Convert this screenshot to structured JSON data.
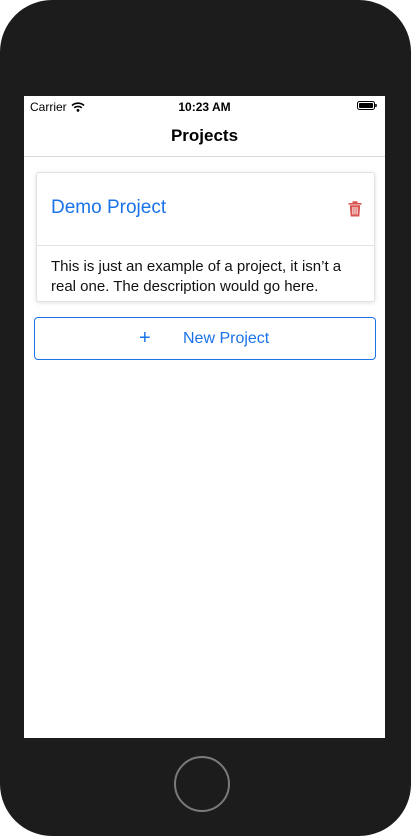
{
  "status_bar": {
    "carrier": "Carrier",
    "time": "10:23 AM",
    "icons": [
      "wifi-icon",
      "battery-icon"
    ]
  },
  "nav": {
    "title": "Projects"
  },
  "projects": [
    {
      "title": "Demo Project",
      "description": "This is just an example of a project, it isn’t a real one. The description would go here.",
      "delete_icon": "trash-icon"
    }
  ],
  "actions": {
    "new_project_label": "New Project",
    "new_project_icon": "+"
  },
  "colors": {
    "accent": "#1a73e8",
    "delete": "#d9534f",
    "device_frame": "#1c1c1c"
  }
}
